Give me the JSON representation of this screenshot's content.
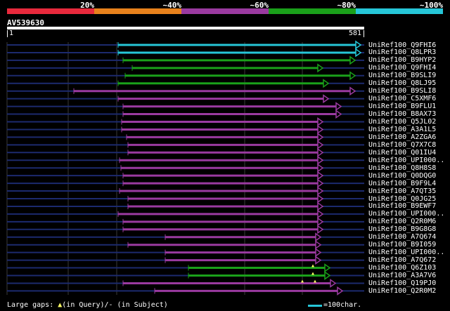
{
  "legend": {
    "colors": [
      "#e8293c",
      "#e8821c",
      "#9a3aa0",
      "#1aa01a",
      "#26c6d8"
    ],
    "labels": [
      "20%",
      "~40%",
      "~60%",
      "~80%",
      "~100%"
    ]
  },
  "query": {
    "name": "AV539630",
    "start": "1",
    "end": "581"
  },
  "hit_colors": {
    "cyan": "#26c6d8",
    "green": "#1aa01a",
    "purple": "#9a3aa0",
    "navy": "#1c2a6e",
    "grid": "#3a3a3a",
    "gap": "#ffff66"
  },
  "hits": [
    {
      "name": "UniRef100_Q9FHI6",
      "color": "cyan"
    },
    {
      "name": "UniRef100_Q8LPR3",
      "color": "cyan"
    },
    {
      "name": "UniRef100_B9HYP2",
      "color": "green"
    },
    {
      "name": "UniRef100_Q9FHI4",
      "color": "green"
    },
    {
      "name": "UniRef100_B9SLI9",
      "color": "green"
    },
    {
      "name": "UniRef100_Q8LJ95",
      "color": "green"
    },
    {
      "name": "UniRef100_B9SLI8",
      "color": "purple"
    },
    {
      "name": "UniRef100_C5XMF6",
      "color": "purple"
    },
    {
      "name": "UniRef100_B9FLU1",
      "color": "purple"
    },
    {
      "name": "UniRef100_B8AX73",
      "color": "purple"
    },
    {
      "name": "UniRef100_Q5JL02",
      "color": "purple"
    },
    {
      "name": "UniRef100_A3A1L5",
      "color": "purple"
    },
    {
      "name": "UniRef100_A2ZGA6",
      "color": "purple"
    },
    {
      "name": "UniRef100_Q7X7C8",
      "color": "purple"
    },
    {
      "name": "UniRef100_Q01IU4",
      "color": "purple"
    },
    {
      "name": "UniRef100_UPI000..",
      "color": "purple"
    },
    {
      "name": "UniRef100_Q8H8S8",
      "color": "purple"
    },
    {
      "name": "UniRef100_Q0DQG0",
      "color": "purple"
    },
    {
      "name": "UniRef100_B9F9L4",
      "color": "purple"
    },
    {
      "name": "UniRef100_A7QT35",
      "color": "purple"
    },
    {
      "name": "UniRef100_Q0JG25",
      "color": "purple"
    },
    {
      "name": "UniRef100_B9EWF7",
      "color": "purple"
    },
    {
      "name": "UniRef100_UPI000..",
      "color": "purple"
    },
    {
      "name": "UniRef100_Q2R0M6",
      "color": "purple"
    },
    {
      "name": "UniRef100_B9G8G8",
      "color": "purple"
    },
    {
      "name": "UniRef100_A7Q674",
      "color": "purple"
    },
    {
      "name": "UniRef100_B9I059",
      "color": "purple"
    },
    {
      "name": "UniRef100_UPI000..",
      "color": "purple"
    },
    {
      "name": "UniRef100_A7Q672",
      "color": "purple"
    },
    {
      "name": "UniRef100_Q6Z103",
      "color": "green"
    },
    {
      "name": "UniRef100_A3A7V6",
      "color": "green"
    },
    {
      "name": "UniRef100_Q19PJ0",
      "color": "purple"
    },
    {
      "name": "UniRef100_Q2R0M2",
      "color": "purple"
    }
  ],
  "footer": {
    "gaps_prefix": "Large gaps: ",
    "gaps_triangle": "▲",
    "gaps_suffix": "(in Query)/- (in Subject)",
    "scale_text": "=100char."
  }
}
